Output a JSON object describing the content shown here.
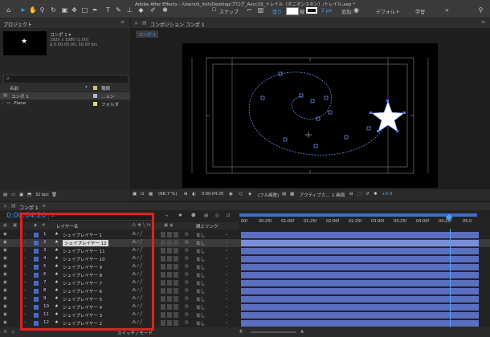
{
  "app": {
    "title": "Adobe After Effects - /Users/k_itoh/Desktop/ブログ_Aecc19_トレイル（オニオンスキン）/トレイル.aep *"
  },
  "toolbar": {
    "snap_label": "スナップ",
    "fill_label": "塗り",
    "stroke_width": "2 px",
    "add_label": "追加:",
    "workspace_default": "デフォルト",
    "workspace_learn": "学習"
  },
  "project_panel": {
    "tab_label": "プロジェクト",
    "item_name": "コンポ 1 ▾",
    "item_info_1": "1920 x 1080 (1.00)",
    "item_info_2": "Δ 0:00:05:00, 50.00 fps",
    "search_placeholder": "ρ.",
    "col_name": "名前",
    "col_type": "種類",
    "items": [
      {
        "name": "コンポ 1",
        "type": "...ョン",
        "color": "#b5b5e0"
      },
      {
        "name": "Plane",
        "type": "フォルダ",
        "color": "#e8d56a"
      }
    ],
    "bpc": "32 bpc"
  },
  "comp_panel": {
    "tab_label": "コンポジション コンポ 1",
    "subtab": "コンポ 1",
    "zoom": "(66.7 %)",
    "timecode": "0:00:04:20",
    "resolution": "(フル画質)",
    "camera": "アクティブカ...",
    "views": "1 画面",
    "offset": "+0.0"
  },
  "timeline": {
    "tab_label": "コンポ 1",
    "timecode": "0:00:04:20",
    "col_layer_name": "レイヤー名",
    "col_parent": "親とリンク",
    "mode_label": "スイッチ / モード",
    "ruler": [
      "00f",
      "00:25f",
      "01:00f",
      "01:25f",
      "02:00f",
      "02:25f",
      "03:00f",
      "03:25f",
      "04:00f",
      "04:25f",
      "05:0"
    ],
    "layers": [
      {
        "num": "1",
        "name": "シェイプレイヤー 1",
        "parent": "なし",
        "selected": false
      },
      {
        "num": "2",
        "name": "シェイプレイヤー 12",
        "parent": "なし",
        "selected": true
      },
      {
        "num": "3",
        "name": "シェイプレイヤー 11",
        "parent": "なし",
        "selected": false
      },
      {
        "num": "4",
        "name": "シェイプレイヤー 10",
        "parent": "なし",
        "selected": false
      },
      {
        "num": "5",
        "name": "シェイプレイヤー 9",
        "parent": "なし",
        "selected": false
      },
      {
        "num": "6",
        "name": "シェイプレイヤー 8",
        "parent": "なし",
        "selected": false
      },
      {
        "num": "7",
        "name": "シェイプレイヤー 7",
        "parent": "なし",
        "selected": false
      },
      {
        "num": "8",
        "name": "シェイプレイヤー 6",
        "parent": "なし",
        "selected": false
      },
      {
        "num": "9",
        "name": "シェイプレイヤー 5",
        "parent": "なし",
        "selected": false
      },
      {
        "num": "10",
        "name": "シェイプレイヤー 4",
        "parent": "なし",
        "selected": false
      },
      {
        "num": "11",
        "name": "シェイプレイヤー 3",
        "parent": "なし",
        "selected": false
      },
      {
        "num": "12",
        "name": "シェイプレイヤー 2",
        "parent": "なし",
        "selected": false
      }
    ]
  },
  "colors": {
    "accent": "#2d8ceb",
    "highlight": "#e02020",
    "layer_bar": "#5a6fbf"
  }
}
